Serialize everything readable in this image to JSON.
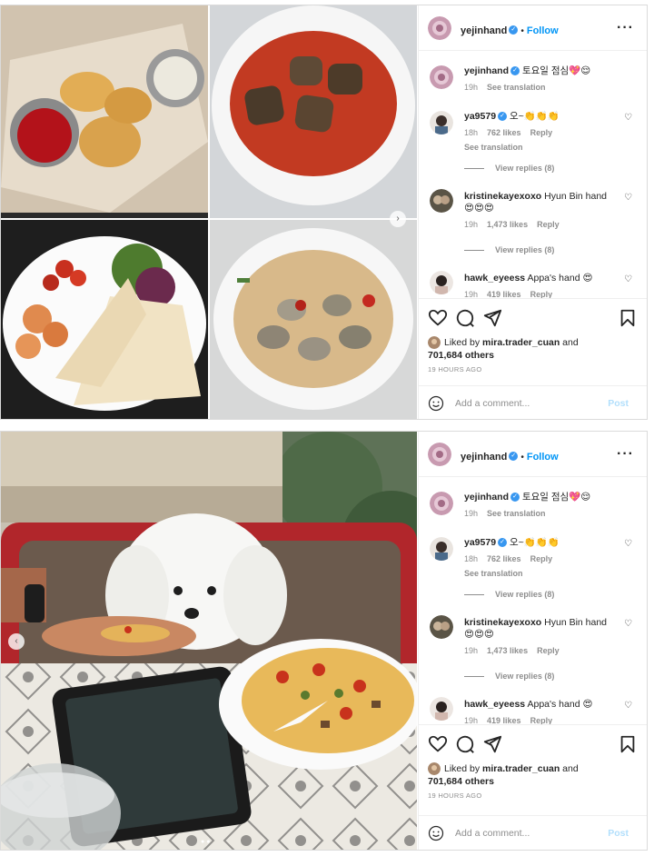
{
  "colors": {
    "accent": "#0095f6",
    "verified": "#3897f0",
    "muted": "#8e8e8e",
    "post_disabled": "#b2dffc"
  },
  "posts": [
    {
      "header": {
        "username": "yejinhand",
        "follow_label": "Follow",
        "more_icon": "more-options-icon"
      },
      "caption": {
        "username": "yejinhand",
        "text": "토요일 점심💖😌",
        "time": "19h",
        "see_translation": "See translation"
      },
      "comments": [
        {
          "username": "ya9579",
          "text": "오~👏👏👏",
          "time": "18h",
          "likes": "762 likes",
          "reply": "Reply",
          "see_translation": "See translation",
          "view_replies": "View replies (8)"
        },
        {
          "username": "kristinekayexoxo",
          "text": "Hyun Bin hand😍😍😍",
          "time": "19h",
          "likes": "1,473 likes",
          "reply": "Reply",
          "view_replies": "View replies (8)"
        },
        {
          "username": "hawk_eyeess",
          "text": "Appa's hand 😍",
          "time": "19h",
          "likes": "419 likes",
          "reply": "Reply"
        }
      ],
      "liked_by": {
        "prefix": "Liked by",
        "user": "mira.trader_cuan",
        "and": "and",
        "others": "701,684 others"
      },
      "timestamp": "19 HOURS AGO",
      "add_comment": {
        "placeholder": "Add a comment...",
        "post_label": "Post"
      }
    },
    {
      "header": {
        "username": "yejinhand",
        "follow_label": "Follow",
        "more_icon": "more-options-icon"
      },
      "caption": {
        "username": "yejinhand",
        "text": "토요일 점심💖😌",
        "time": "19h",
        "see_translation": "See translation"
      },
      "comments": [
        {
          "username": "ya9579",
          "text": "오~👏👏👏",
          "time": "18h",
          "likes": "762 likes",
          "reply": "Reply",
          "see_translation": "See translation",
          "view_replies": "View replies (8)"
        },
        {
          "username": "kristinekayexoxo",
          "text": "Hyun Bin hand😍😍😍",
          "time": "19h",
          "likes": "1,473 likes",
          "reply": "Reply",
          "view_replies": "View replies (8)"
        },
        {
          "username": "hawk_eyeess",
          "text": "Appa's hand 😍",
          "time": "19h",
          "likes": "419 likes",
          "reply": "Reply"
        }
      ],
      "liked_by": {
        "prefix": "Liked by",
        "user": "mira.trader_cuan",
        "and": "and",
        "others": "701,684 others"
      },
      "timestamp": "19 HOURS AGO",
      "add_comment": {
        "placeholder": "Add a comment...",
        "post_label": "Post"
      }
    }
  ],
  "icons": [
    "heart-icon",
    "comment-icon",
    "share-icon",
    "bookmark-icon",
    "emoji-icon",
    "verified-badge-icon",
    "carousel-next-icon",
    "carousel-prev-icon"
  ]
}
